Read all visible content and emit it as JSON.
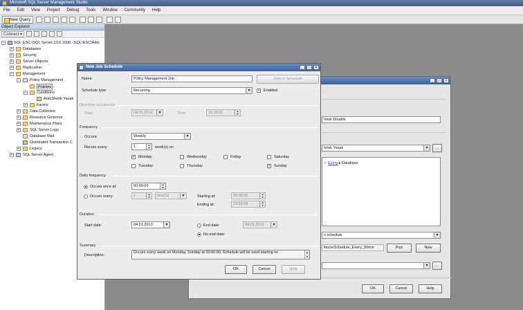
{
  "app": {
    "title": "Microsoft SQL Server Management Studio",
    "menu": [
      "File",
      "Edit",
      "View",
      "Project",
      "Debug",
      "Tools",
      "Window",
      "Community",
      "Help"
    ],
    "toolbar": {
      "new_query": "New Query"
    }
  },
  "object_explorer": {
    "title": "Object Explorer",
    "connect": "Connect ▾",
    "tree": {
      "server": "SQL-ESC (SQL Server 10.0.1600 - SQL-ESC\\Adm",
      "databases": "Databases",
      "security": "Security",
      "server_objects": "Server Objects",
      "replication": "Replication",
      "management": "Management",
      "policy_management": "Policy Management",
      "policies": "Policies",
      "conditions": "Conditions",
      "autoshrink": "AutoShrink Yasak",
      "facets": "Facets",
      "data_collection": "Data Collection",
      "resource_governor": "Resource Governor",
      "maintenance_plans": "Maintenance Plans",
      "sql_server_logs": "SQL Server Logs",
      "database_mail": "Database Mail",
      "dtc": "Distributed Transaction C",
      "legacy": "Legacy",
      "sql_agent": "SQL Server Agent"
    }
  },
  "back_dialog": {
    "name_value": "hrink Disable",
    "condition_value": "hrink Yasak",
    "against_link": "Every",
    "against_text": "▸ Database",
    "schedule_value": "n schedule",
    "schedule_name": "llectorSchedule_Every_30min",
    "pick_button": "Pick",
    "new_button": "New",
    "ok": "OK",
    "cancel": "Cancel",
    "help": "Help"
  },
  "job_schedule": {
    "title": "New Job Schedule",
    "name_label": "Name:",
    "name_value": "Policy Management Job",
    "jobs_button": "Jobs in Schedule",
    "schedule_type_label": "Schedule type:",
    "schedule_type_value": "Recurring",
    "enabled_label": "Enabled",
    "one_time": {
      "group": "One-time occurrence",
      "date_label": "Date:",
      "date_value": "04.01.2010",
      "time_label": "Time:",
      "time_value": "16:39:20"
    },
    "frequency": {
      "group": "Frequency",
      "occurs_label": "Occurs:",
      "occurs_value": "Weekly",
      "recurs_label": "Recurs every:",
      "recurs_value": "1",
      "recurs_unit": "week(s) on",
      "days": {
        "monday": "Monday",
        "wednesday": "Wednesday",
        "friday": "Friday",
        "saturday": "Saturday",
        "tuesday": "Tuesday",
        "thursday": "Thursday",
        "sunday": "Sunday"
      }
    },
    "daily": {
      "group": "Daily frequency",
      "once_label": "Occurs once at:",
      "once_value": "00:00:00",
      "every_label": "Occurs every:",
      "every_value": "1",
      "every_unit": "hour(s)",
      "starting_label": "Starting at:",
      "starting_value": "00:00:00",
      "ending_label": "Ending at:",
      "ending_value": "23:59:59"
    },
    "duration": {
      "group": "Duration",
      "start_label": "Start date:",
      "start_value": "04.01.2010",
      "end_label": "End date:",
      "end_value": "04.01.2010",
      "no_end_label": "No end date:"
    },
    "summary": {
      "group": "Summary",
      "desc_label": "Description:",
      "desc_value": "Occurs every week on Monday, Sunday at 00:00:00. Schedule will be used starting on"
    },
    "ok": "OK",
    "cancel": "Cancel",
    "help": "Help"
  }
}
